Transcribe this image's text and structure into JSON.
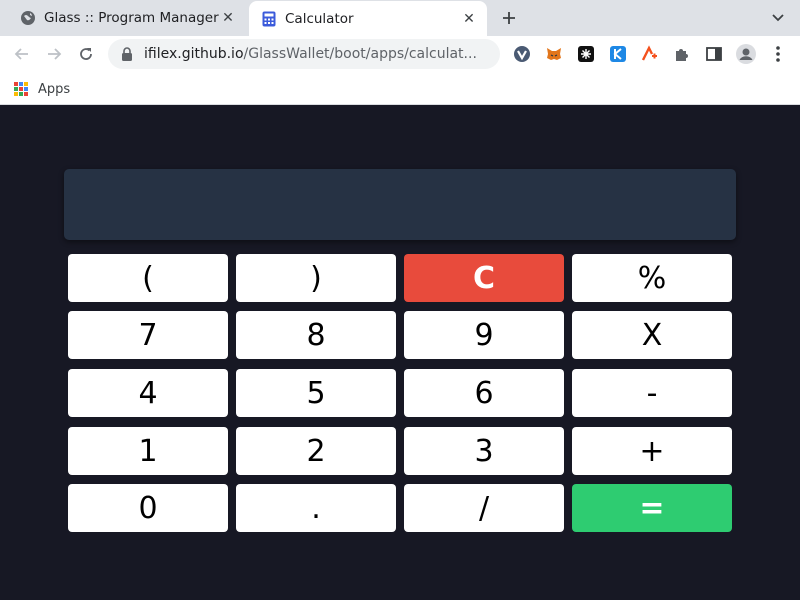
{
  "browser": {
    "tabs": [
      {
        "title": "Glass :: Program Manager",
        "favicon": "globe-icon",
        "active": false
      },
      {
        "title": "Calculator",
        "favicon": "calculator-icon",
        "active": true
      }
    ],
    "address": {
      "host": "ifilex.github.io",
      "path": "/GlassWallet/boot/apps/calculat..."
    },
    "extensions": [
      "vivaldi-extension-icon",
      "metamask-extension-icon",
      "wallet-extension-icon",
      "k-extension-icon",
      "ai-extension-icon",
      "extensions-puzzle-icon",
      "side-panel-icon",
      "profile-icon",
      "menu-kebab-icon"
    ],
    "bookmarks": {
      "apps_label": "Apps"
    }
  },
  "calculator": {
    "display_value": "",
    "keys": [
      {
        "label": "(",
        "name": "open-paren"
      },
      {
        "label": ")",
        "name": "close-paren"
      },
      {
        "label": "C",
        "name": "clear"
      },
      {
        "label": "%",
        "name": "percent"
      },
      {
        "label": "7",
        "name": "seven"
      },
      {
        "label": "8",
        "name": "eight"
      },
      {
        "label": "9",
        "name": "nine"
      },
      {
        "label": "X",
        "name": "multiply"
      },
      {
        "label": "4",
        "name": "four"
      },
      {
        "label": "5",
        "name": "five"
      },
      {
        "label": "6",
        "name": "six"
      },
      {
        "label": "-",
        "name": "subtract"
      },
      {
        "label": "1",
        "name": "one"
      },
      {
        "label": "2",
        "name": "two"
      },
      {
        "label": "3",
        "name": "three"
      },
      {
        "label": "+",
        "name": "add"
      },
      {
        "label": "0",
        "name": "zero"
      },
      {
        "label": ".",
        "name": "decimal"
      },
      {
        "label": "/",
        "name": "divide"
      },
      {
        "label": "=",
        "name": "equals"
      }
    ],
    "colors": {
      "background": "#171824",
      "display": "#263244",
      "clear": "#e84b3c",
      "equals": "#2ecc71",
      "key": "#ffffff"
    }
  }
}
